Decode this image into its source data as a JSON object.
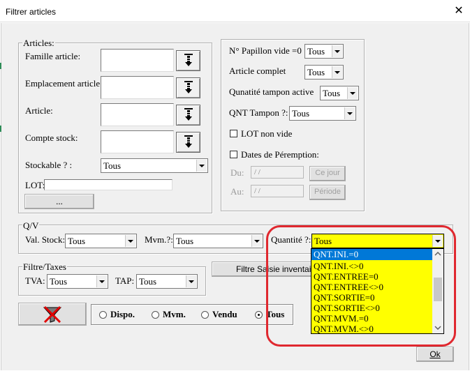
{
  "window": {
    "title": "Filtrer articles",
    "close_glyph": "✕"
  },
  "articles": {
    "group_label": "Articles:",
    "famille_label": "Famille article:",
    "emplacement_label": "Emplacement article:",
    "article_label": "Article:",
    "compte_label": "Compte stock:",
    "stockable_label": "Stockable ? :",
    "stockable_value": "Tous",
    "lot_label": "LOT:",
    "ellipsis_button": "..."
  },
  "right": {
    "papillon_label": "N° Papillon vide =0",
    "papillon_value": "Tous",
    "complet_label": "Article complet",
    "complet_value": "Tous",
    "tampon_active_label": "Qunatité tampon active",
    "tampon_active_value": "Tous",
    "qnt_tampon_label": "QNT Tampon ?:",
    "qnt_tampon_value": "Tous",
    "lot_non_vide_label": "LOT non vide",
    "peremption_label": "Dates de Péremption:",
    "du_label": "Du:",
    "du_value": "/ /",
    "au_label": "Au:",
    "au_value": "/ /",
    "ce_jour_button": "Ce jour",
    "periode_button": "Période"
  },
  "qv": {
    "group_label": "Q/V",
    "val_stock_label": "Val. Stock:",
    "val_stock_value": "Tous",
    "mvm_label": "Mvm.?:",
    "mvm_value": "Tous",
    "quantite_label": "Quantité ?:",
    "quantite_value": "Tous",
    "options": [
      "QNT.INI.=0",
      "QNT.INI.<>0",
      "QNT.ENTREE=0",
      "QNT.ENTREE<>0",
      "QNT.SORTIE=0",
      "QNT.SORTIE<>0",
      "QNT.MVM.=0",
      "QNT.MVM.<>0"
    ]
  },
  "taxes": {
    "group_label": "Filtre/Taxes",
    "tva_label": "TVA:",
    "tva_value": "Tous",
    "tap_label": "TAP:",
    "tap_value": "Tous"
  },
  "saisie_button": "Filtre Saisie inventaire",
  "status": {
    "dispo": "Dispo.",
    "mvm": "Mvm.",
    "vendu": "Vendu",
    "tous": "Tous",
    "selected": "tous"
  },
  "ok_button": "Ok",
  "colors": {
    "dropdown_bg": "#ffff00",
    "selection": "#0078d7",
    "highlight_border": "#e0282f"
  }
}
